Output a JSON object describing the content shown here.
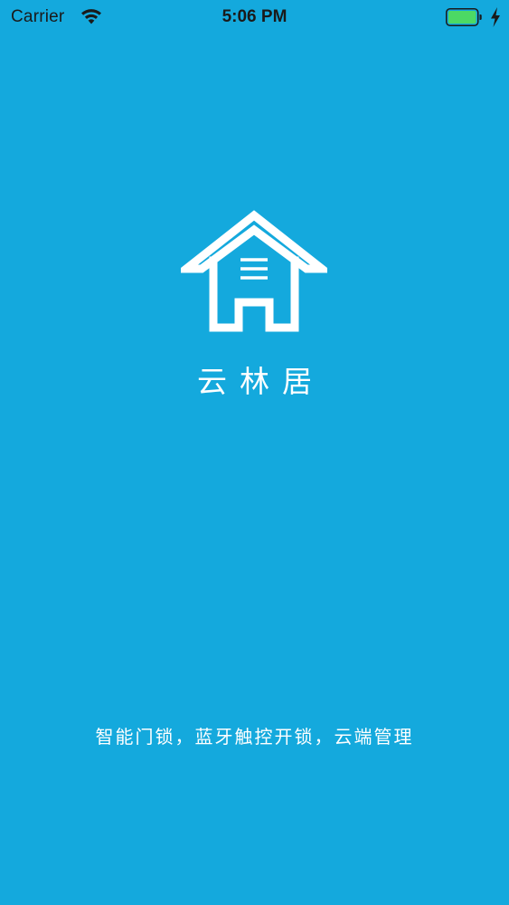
{
  "status_bar": {
    "carrier": "Carrier",
    "time": "5:06 PM",
    "wifi_icon": "wifi-icon",
    "battery_icon": "battery-full-icon",
    "charging_icon": "charging-bolt-icon",
    "battery_color": "#4cd964"
  },
  "splash": {
    "logo_icon": "house-icon",
    "app_name": "云林居",
    "tagline": "智能门锁，蓝牙触控开锁，云端管理",
    "background_color": "#14a9dd"
  }
}
